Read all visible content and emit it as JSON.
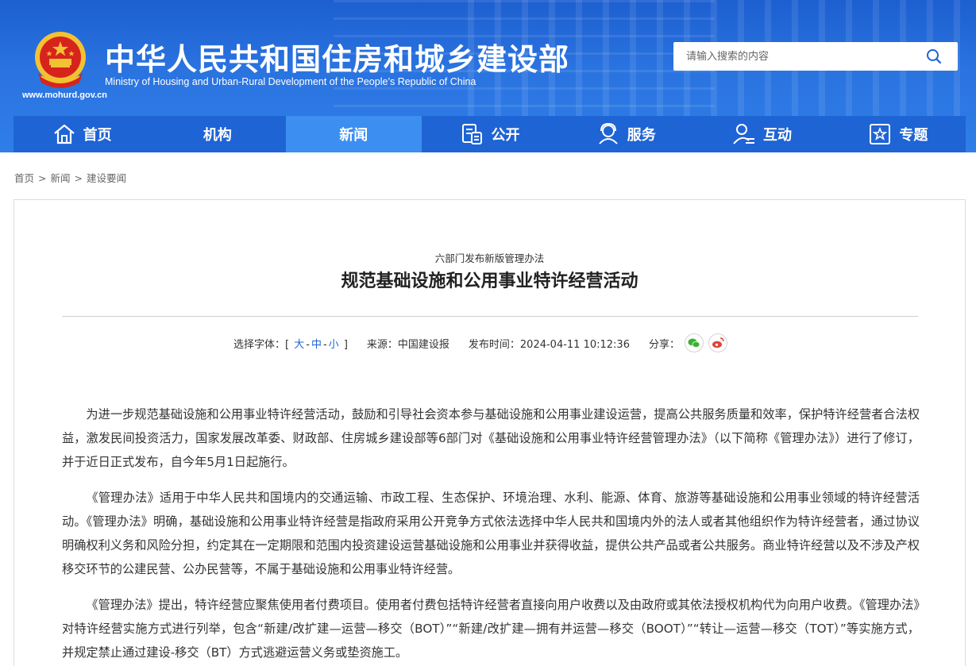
{
  "header": {
    "title": "中华人民共和国住房和城乡建设部",
    "subtitle": "Ministry of Housing and Urban-Rural Development of the People’s Republic of China",
    "url": "www.mohurd.gov.cn",
    "search_placeholder": "请输入搜索的内容"
  },
  "nav": {
    "items": [
      {
        "label": "首页",
        "icon": "home-icon"
      },
      {
        "label": "机构",
        "icon": ""
      },
      {
        "label": "新闻",
        "icon": "",
        "active": true
      },
      {
        "label": "公开",
        "icon": "document-icon"
      },
      {
        "label": "服务",
        "icon": "service-icon"
      },
      {
        "label": "互动",
        "icon": "interact-icon"
      },
      {
        "label": "专题",
        "icon": "star-icon"
      }
    ]
  },
  "breadcrumb": {
    "items": [
      "首页",
      "新闻",
      "建设要闻"
    ],
    "sep": ">"
  },
  "article": {
    "kicker": "六部门发布新版管理办法",
    "title": "规范基础设施和公用事业特许经营活动",
    "meta": {
      "font_label": "选择字体：[",
      "font_large": "大",
      "font_medium": "中",
      "font_small": "小",
      "font_dash": "-",
      "font_close": "]",
      "source": "来源：中国建设报",
      "time": "发布时间：2024-04-11 10:12:36",
      "share": "分享："
    },
    "paragraphs": [
      "为进一步规范基础设施和公用事业特许经营活动，鼓励和引导社会资本参与基础设施和公用事业建设运营，提高公共服务质量和效率，保护特许经营者合法权益，激发民间投资活力，国家发展改革委、财政部、住房城乡建设部等6部门对《基础设施和公用事业特许经营管理办法》（以下简称《管理办法》）进行了修订，并于近日正式发布，自今年5月1日起施行。",
      "《管理办法》适用于中华人民共和国境内的交通运输、市政工程、生态保护、环境治理、水利、能源、体育、旅游等基础设施和公用事业领域的特许经营活动。《管理办法》明确，基础设施和公用事业特许经营是指政府采用公开竞争方式依法选择中华人民共和国境内外的法人或者其他组织作为特许经营者，通过协议明确权利义务和风险分担，约定其在一定期限和范围内投资建设运营基础设施和公用事业并获得收益，提供公共产品或者公共服务。商业特许经营以及不涉及产权移交环节的公建民营、公办民营等，不属于基础设施和公用事业特许经营。",
      "《管理办法》提出，特许经营应聚焦使用者付费项目。使用者付费包括特许经营者直接向用户收费以及由政府或其依法授权机构代为向用户收费。《管理办法》对特许经营实施方式进行列举，包含“新建/改扩建—运营—移交（BOT）”“新建/改扩建—拥有并运营—移交（BOOT）”“转让—运营—移交（TOT）”等实施方式，并规定禁止通过建设-移交（BT）方式逃避运营义务或垫资施工。"
    ]
  },
  "colors": {
    "header_blue": "#2a73e0",
    "nav_blue": "#1f64d4",
    "nav_active": "#3c8ff0",
    "wechat_green": "#3cb034",
    "weibo_red": "#e0433a"
  }
}
